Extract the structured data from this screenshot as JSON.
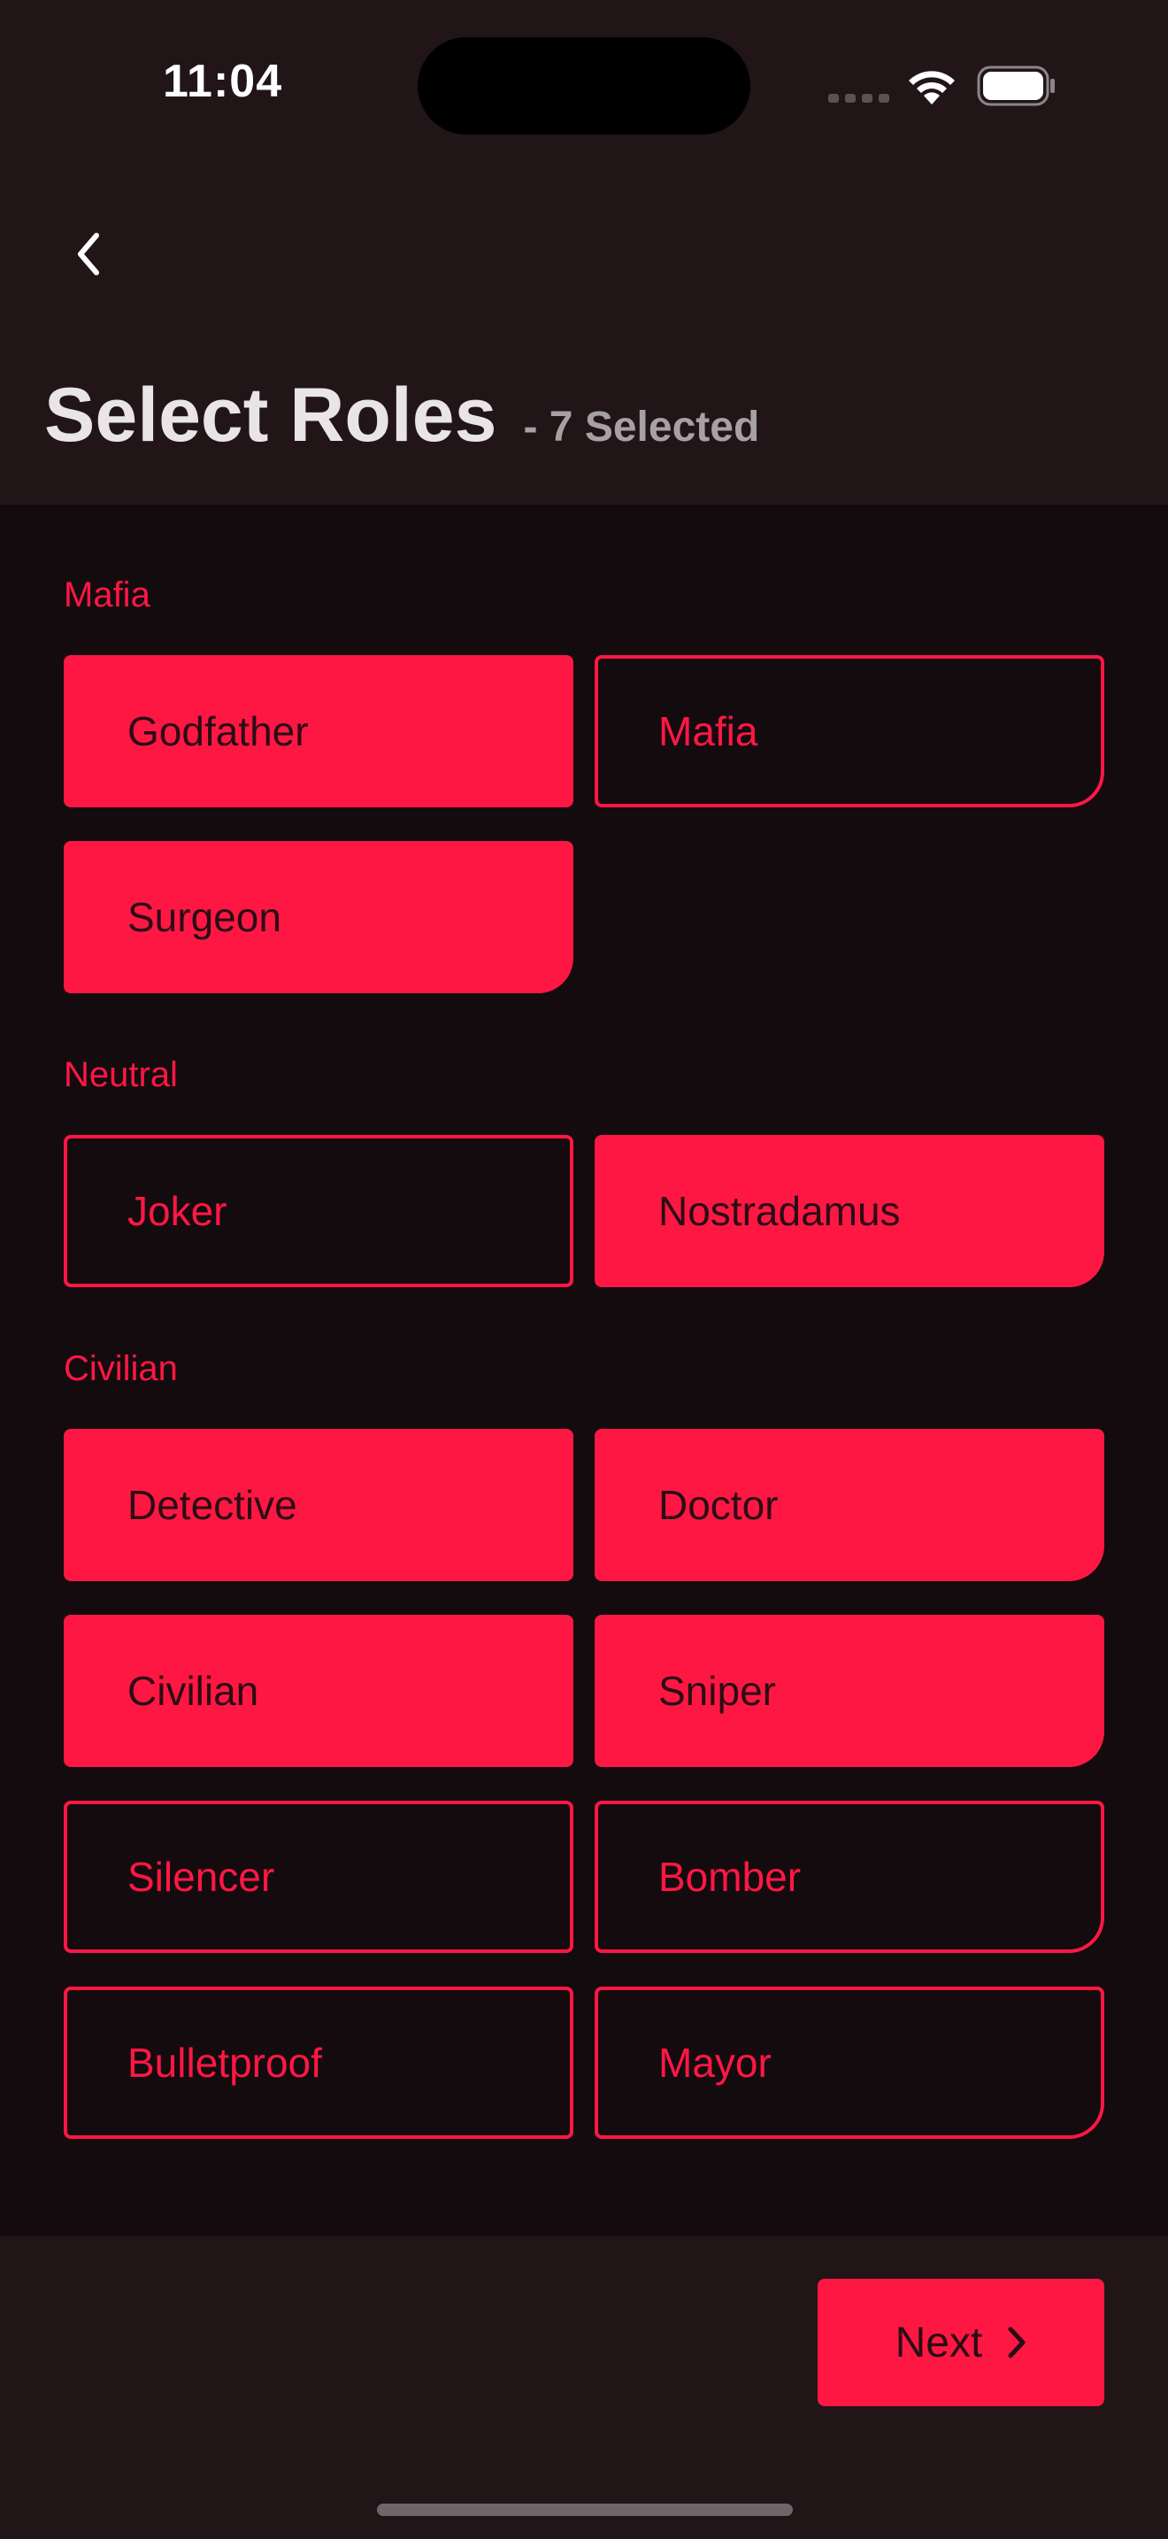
{
  "status_bar": {
    "time": "11:04"
  },
  "header": {
    "back_icon": "chevron-left-icon",
    "title": "Select Roles",
    "subtitle": "- 7 Selected"
  },
  "colors": {
    "accent": "#ff1744",
    "background": "#140b0f",
    "header_background": "#221518"
  },
  "sections": [
    {
      "label": "Mafia",
      "roles": [
        {
          "label": "Godfather",
          "selected": true
        },
        {
          "label": "Mafia",
          "selected": false
        },
        {
          "label": "Surgeon",
          "selected": true
        }
      ]
    },
    {
      "label": "Neutral",
      "roles": [
        {
          "label": "Joker",
          "selected": false
        },
        {
          "label": "Nostradamus",
          "selected": true
        }
      ]
    },
    {
      "label": "Civilian",
      "roles": [
        {
          "label": "Detective",
          "selected": true
        },
        {
          "label": "Doctor",
          "selected": true
        },
        {
          "label": "Civilian",
          "selected": true
        },
        {
          "label": "Sniper",
          "selected": true
        },
        {
          "label": "Silencer",
          "selected": false
        },
        {
          "label": "Bomber",
          "selected": false
        },
        {
          "label": "Bulletproof",
          "selected": false
        },
        {
          "label": "Mayor",
          "selected": false
        }
      ]
    }
  ],
  "footer": {
    "next_label": "Next",
    "next_icon": "chevron-right-icon"
  }
}
